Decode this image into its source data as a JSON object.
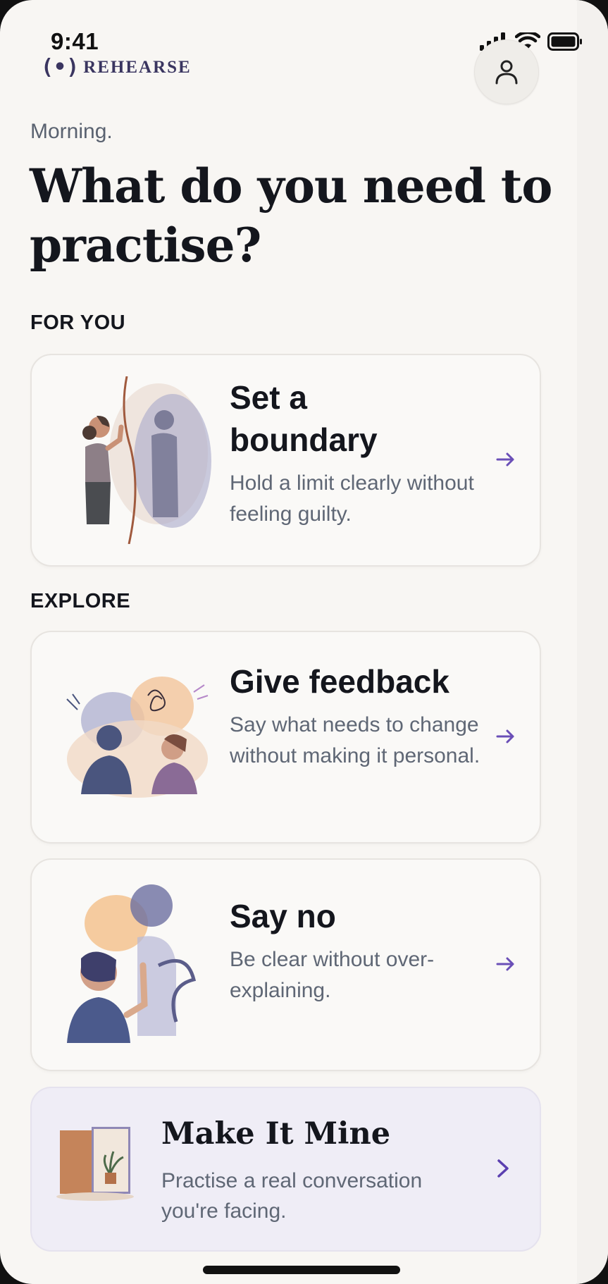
{
  "status_bar": {
    "time": "9:41"
  },
  "brand": {
    "mark": "(•)",
    "name": "REHEARSE"
  },
  "greeting": "Morning.",
  "headline": "What do you need to practise?",
  "sections": {
    "for_you": "FOR YOU",
    "explore": "EXPLORE"
  },
  "cards": [
    {
      "title": "Set a boundary",
      "description": "Hold a limit clearly without feeling guilty."
    },
    {
      "title": "Give feedback",
      "description": "Say what needs to change without making it personal."
    },
    {
      "title": "Say no",
      "description": "Be clear without over-explaining."
    }
  ],
  "make_it_mine": {
    "title": "Make It Mine",
    "description": "Practise a real conversation you're facing."
  },
  "colors": {
    "accent": "#6a4fb7",
    "background": "#f8f6f3",
    "card": "#faf9f7",
    "highlight_card": "#efedf6"
  },
  "icons": [
    "signal-icon",
    "wifi-icon",
    "battery-icon",
    "profile-icon",
    "arrow-right-icon",
    "chevron-right-icon"
  ]
}
